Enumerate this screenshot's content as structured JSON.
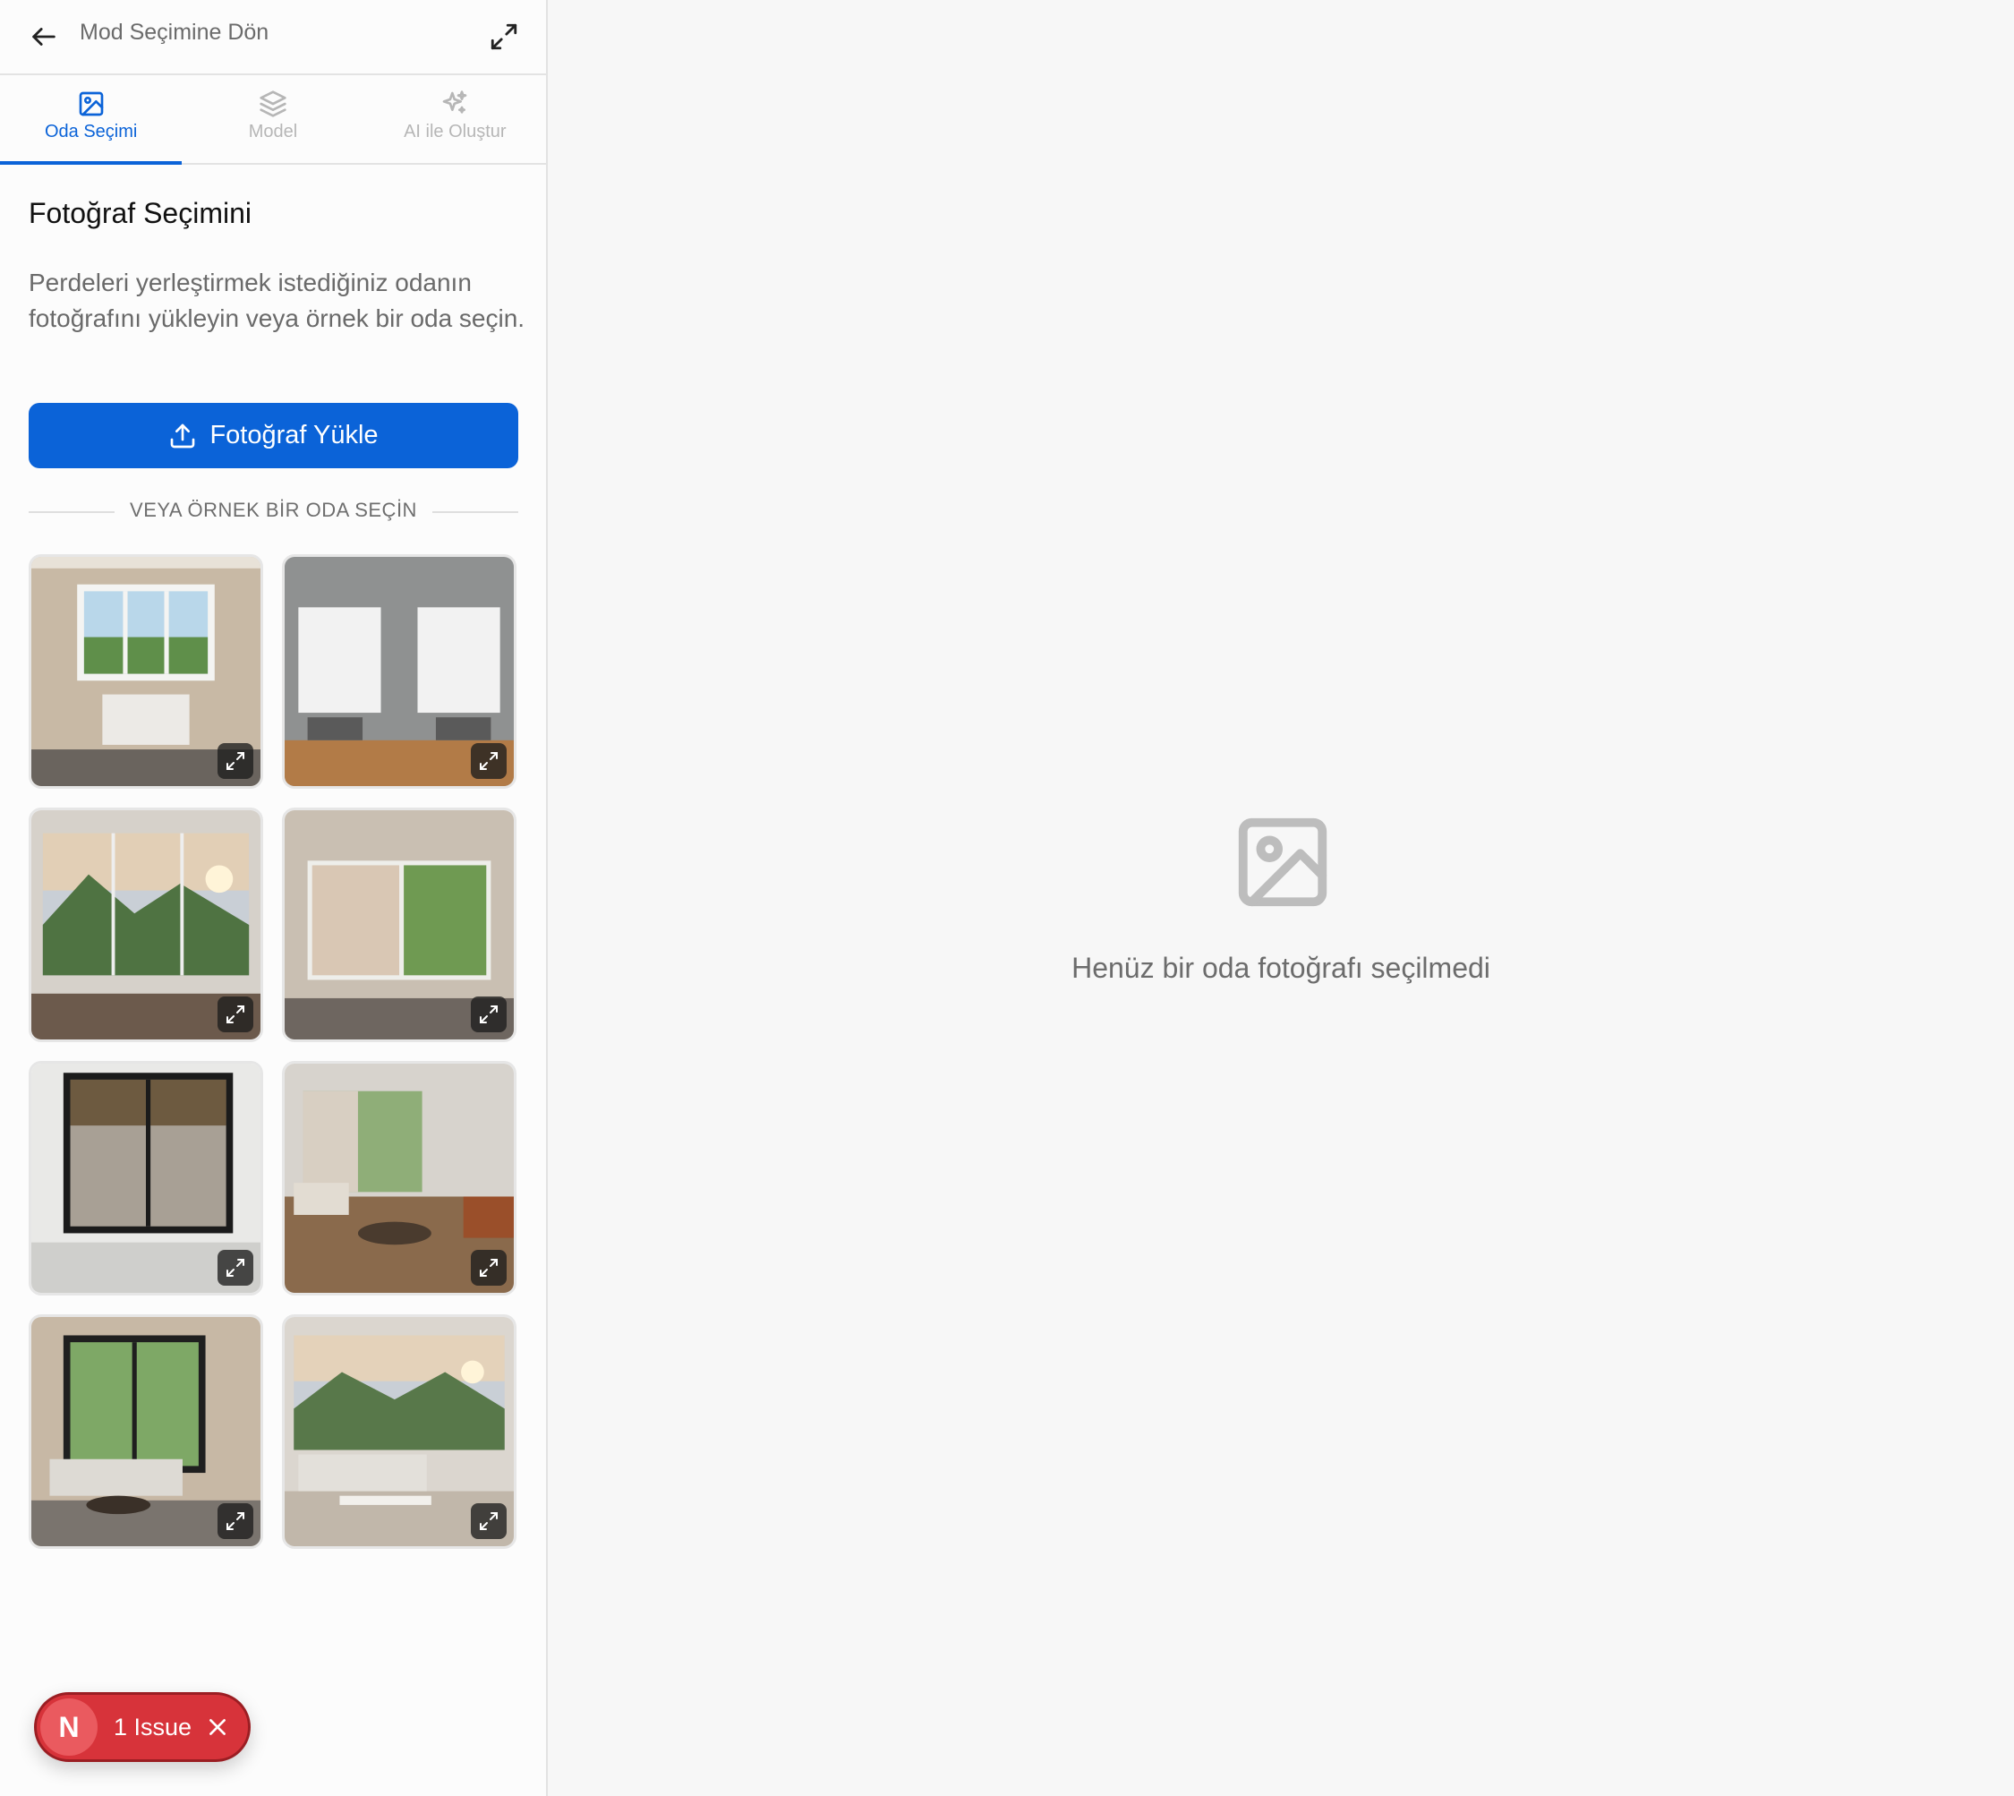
{
  "header": {
    "back_label": "Mod Seçimine Dön",
    "back_icon": "arrow-left-icon",
    "expand_icon": "expand-icon"
  },
  "tabs": [
    {
      "label": "Oda Seçimi",
      "icon": "image-icon",
      "active": true
    },
    {
      "label": "Model",
      "icon": "layers-icon",
      "active": false
    },
    {
      "label": "AI ile Oluştur",
      "icon": "sparkles-icon",
      "active": false
    }
  ],
  "panel": {
    "title": "Fotoğraf Seçimini",
    "description": "Perdeleri yerleştirmek istediğiniz odanın fotoğrafını yükleyin veya örnek bir oda seçin.",
    "upload_label": "Fotoğraf Yükle",
    "divider_text": "VEYA ÖRNEK BİR ODA SEÇİN"
  },
  "sample_rooms_count": 8,
  "empty_state": {
    "text": "Henüz bir oda fotoğrafı seçilmedi",
    "icon": "image-placeholder-icon"
  },
  "issue_badge": {
    "letter": "N",
    "label": "1 Issue"
  },
  "colors": {
    "accent": "#0b63d8",
    "issue_red": "#d7333a",
    "background": "#f7f7f7"
  }
}
